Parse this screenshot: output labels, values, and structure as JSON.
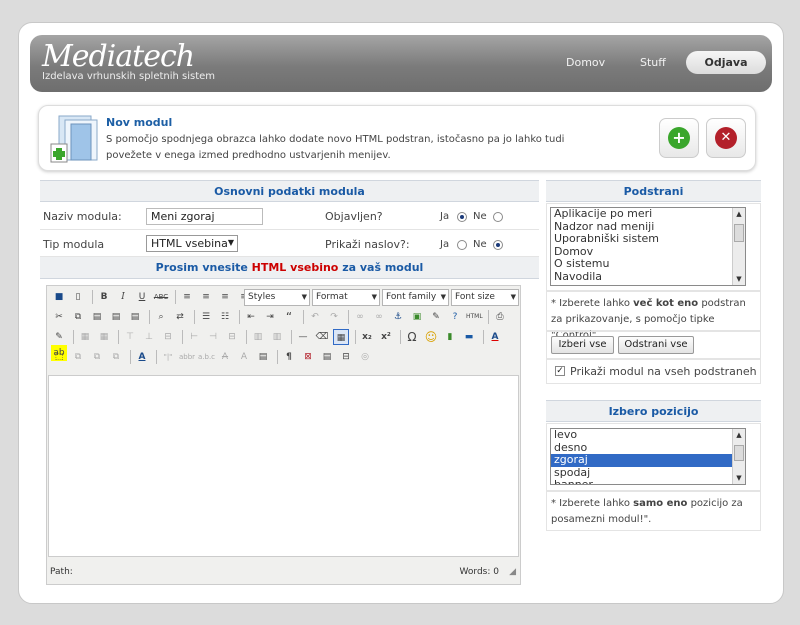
{
  "header": {
    "logo": "Mediatech",
    "tagline": "Izdelava vrhunskih spletnih sistem",
    "nav": [
      "Domov",
      "Stuff"
    ],
    "logout_label": "Odjava"
  },
  "module": {
    "title": "Nov modul",
    "description": "S pomočjo spodnjega obrazca lahko dodate novo HTML podstran, istočasno pa jo lahko tudi povežete v enega izmed predhodno ustvarjenih menijev.",
    "add_icon": "+",
    "delete_icon": "✕"
  },
  "basic": {
    "heading": "Osnovni podatki modula",
    "name_label": "Naziv modula:",
    "name_value": "Meni zgoraj",
    "published_label": "Objavljen?",
    "type_label": "Tip modula",
    "type_value": "HTML vsebina",
    "show_title_label": "Prikaži naslov?:",
    "yes": "Ja",
    "no": "Ne"
  },
  "editor": {
    "prompt_prefix": "Prosim vnesite ",
    "prompt_highlight": "HTML vsebino",
    "prompt_suffix": " za vaš modul",
    "styles": "Styles",
    "format": "Format",
    "font_family": "Font family",
    "font_size": "Font size",
    "path_label": "Path:",
    "words_label": "Words: 0"
  },
  "subpages": {
    "heading": "Podstrani",
    "items": [
      "Aplikacije po meri",
      "Nadzor nad meniji",
      "Uporabniški sistem",
      "Domov",
      "O sistemu",
      "Navodila"
    ],
    "note_prefix": "* Izberete lahko ",
    "note_bold": "več kot eno",
    "note_suffix": " podstran za prikazovanje, s pomočjo tipke \"Control\".",
    "select_all": "Izberi vse",
    "remove_all": "Odstrani vse",
    "show_all_label": "Prikaži modul na vseh podstraneh"
  },
  "position": {
    "heading": "Izbero pozicijo",
    "items": [
      "levo",
      "desno",
      "zgoraj",
      "spodaj",
      "banner"
    ],
    "selected": "zgoraj",
    "note_prefix": "* Izberete lahko ",
    "note_bold": "samo eno",
    "note_suffix": " pozicijo za posamezni modul!\"."
  },
  "colors": {
    "accent": "#1a5aa5",
    "highlight": "#cc0000",
    "add": "#3aa62c",
    "delete": "#b3202a",
    "selection": "#316ac5"
  }
}
